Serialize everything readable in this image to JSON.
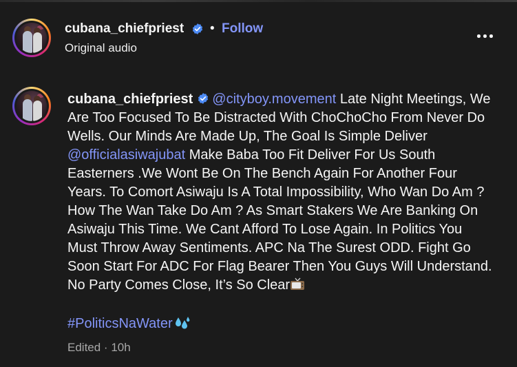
{
  "post_header": {
    "username": "cubana_chiefpriest",
    "separator": "•",
    "follow_label": "Follow",
    "audio_label": "Original audio",
    "more_icon": "more-horizontal-icon"
  },
  "comment": {
    "username": "cubana_chiefpriest",
    "mention_1": "@cityboy.movement",
    "text_1": " Late Night Meetings, We Are Too Focused To Be Distracted With ChoChoCho From Never Do Wells. Our Minds Are Made Up, The Goal Is Simple Deliver ",
    "mention_2": "@officialasiwajubat",
    "text_2": " Make Baba Too Fit Deliver For Us South Easterners .We Wont Be On The Bench Again For Another Four Years. To Comort Asiwaju Is A Total Impossibility, Who Wan Do Am ? How The Wan Take Do Am ? As Smart Stakers We Are Banking On Asiwaju This Time. We Cant Afford To Lose Again. In Politics You Must Throw Away Sentiments. APC Na The Surest ODD. Fight Go Soon Start For ADC For Flag Bearer Then You Guys Will Understand. No Party Comes Close, It’s So Clear",
    "trailing_emoji": "television-emoji",
    "hashtag": "#PoliticsNaWater",
    "hashtag_emoji": "sweat-droplets-emoji",
    "edited_label": "Edited",
    "meta_separator": " · ",
    "time": "10h"
  },
  "colors": {
    "background": "#1b1b1b",
    "text": "#f5f5f5",
    "link": "#8395f8",
    "verified": "#4d8bf5",
    "meta": "#a8a8a8"
  }
}
